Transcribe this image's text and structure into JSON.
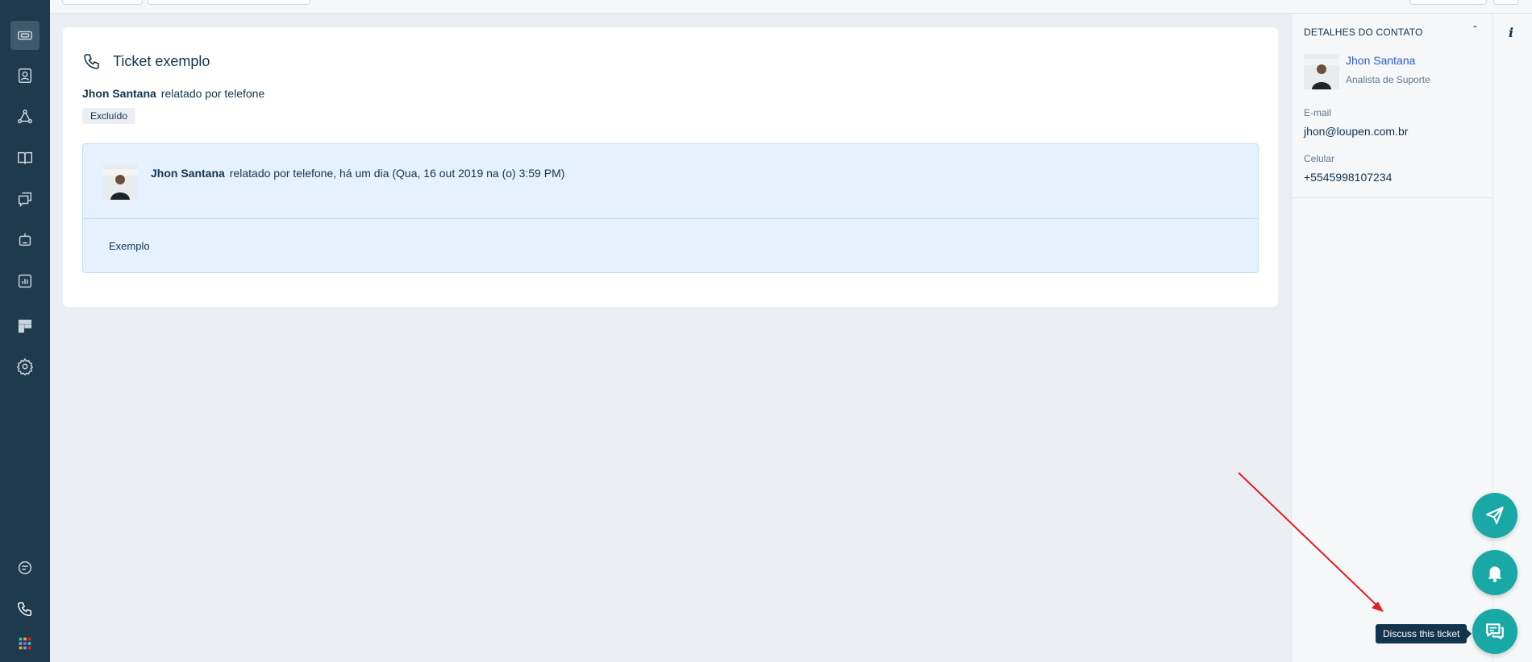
{
  "ticket": {
    "title": "Ticket exemplo",
    "reporter": "Jhon Santana",
    "reported_via": "relatado por telefone",
    "status_tag": "Excluído"
  },
  "conversation": {
    "author": "Jhon Santana",
    "meta": "relatado por telefone, há um dia (Qua, 16 out 2019 na (o) 3:59 PM)",
    "body": "Exemplo"
  },
  "contact": {
    "heading": "DETALHES DO CONTATO",
    "name": "Jhon Santana",
    "role": "Analista de Suporte",
    "email_label": "E-mail",
    "email": "jhon@loupen.com.br",
    "phone_label": "Celular",
    "phone": "+5545998107234"
  },
  "floating": {
    "tooltip": "Discuss this ticket"
  },
  "colors": {
    "nav_bg": "#1f3a4d",
    "accent_teal": "#1aa8a7",
    "conversation_bg": "#e5f2fd",
    "link_blue": "#2c5cc5",
    "annotation_arrow": "#e02020"
  },
  "icons": [
    "tickets-icon",
    "contacts-icon",
    "groups-icon",
    "solutions-icon",
    "forums-icon",
    "bots-icon",
    "reports-icon",
    "dashboard-icon",
    "settings-icon",
    "chat-icon",
    "phone-icon",
    "apps-grid-icon",
    "send-icon",
    "bell-icon",
    "discuss-icon",
    "info-icon"
  ]
}
